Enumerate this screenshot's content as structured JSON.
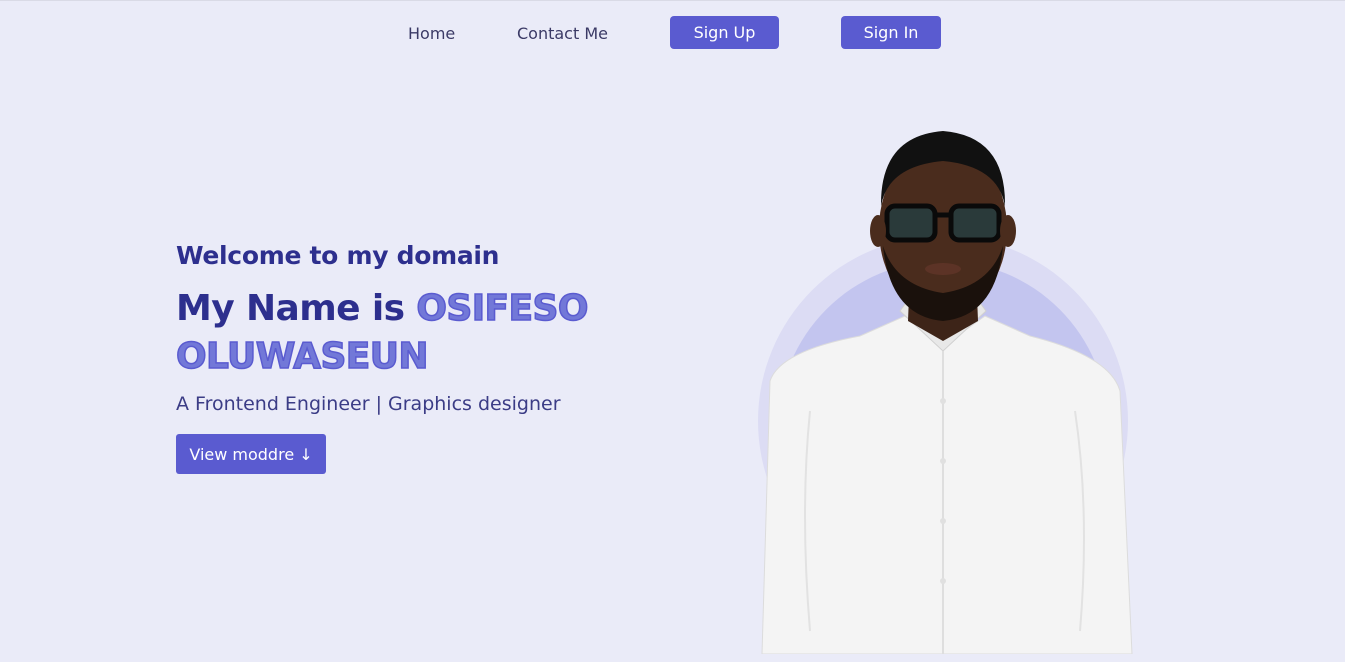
{
  "nav": {
    "home": "Home",
    "contact": "Contact Me",
    "signup": "Sign Up",
    "signin": "Sign In"
  },
  "hero": {
    "welcome": "Welcome to my domain",
    "name_prefix": "My Name is",
    "name_highlight": "OSIFESO OLUWASEUN",
    "subtitle": "A Frontend Engineer | Graphics designer",
    "cta": "View moddre ↓"
  },
  "colors": {
    "background": "#eaebf8",
    "accent": "#5a5bd0",
    "heading": "#2d2f8e",
    "highlight": "#7278d8",
    "circle_outer": "#dcdcf4",
    "circle_inner": "#c3c5ef"
  }
}
